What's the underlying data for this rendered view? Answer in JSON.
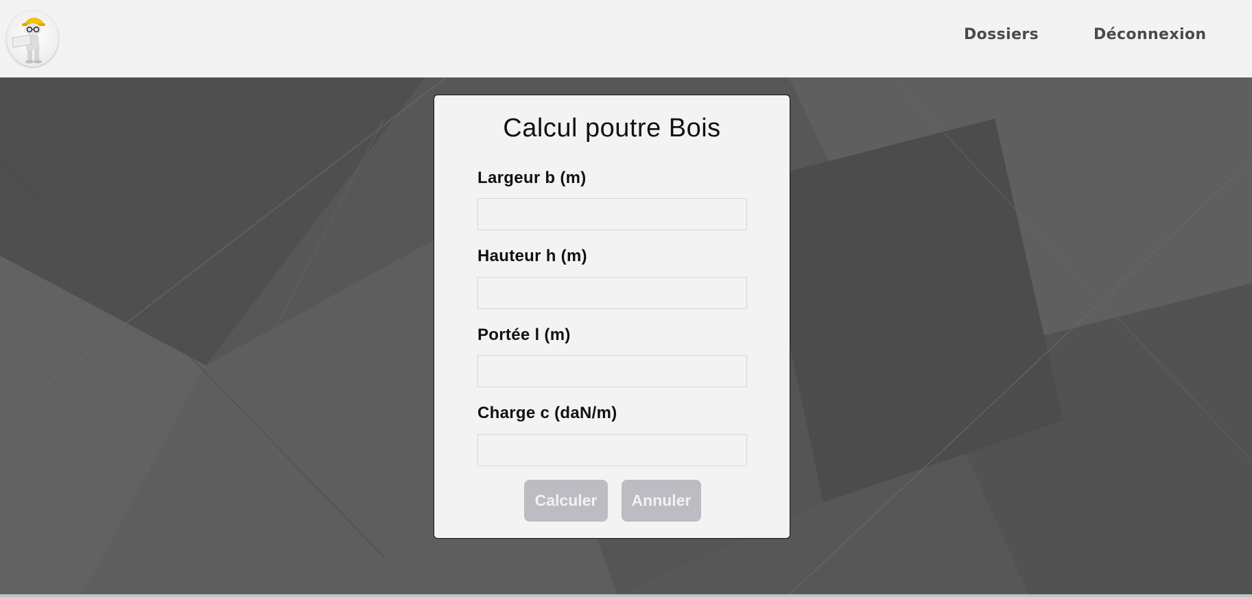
{
  "header": {
    "logo_icon": "engineer-mascot-icon",
    "nav": {
      "dossiers": "Dossiers",
      "logout": "Déconnexion"
    }
  },
  "form": {
    "title": "Calcul poutre Bois",
    "fields": [
      {
        "label": "Largeur b (m)",
        "value": "",
        "placeholder": ""
      },
      {
        "label": "Hauteur h (m)",
        "value": "",
        "placeholder": ""
      },
      {
        "label": "Portée l (m)",
        "value": "",
        "placeholder": ""
      },
      {
        "label": "Charge c (daN/m)",
        "value": "",
        "placeholder": ""
      }
    ],
    "buttons": {
      "submit": "Calculer",
      "cancel": "Annuler"
    }
  },
  "colors": {
    "header_bg": "#f3f3f3",
    "page_bg": "#575757",
    "card_bg": "#f3f3f3",
    "button_bg": "#bcbcc2",
    "nav_text": "#4a4a4a"
  }
}
